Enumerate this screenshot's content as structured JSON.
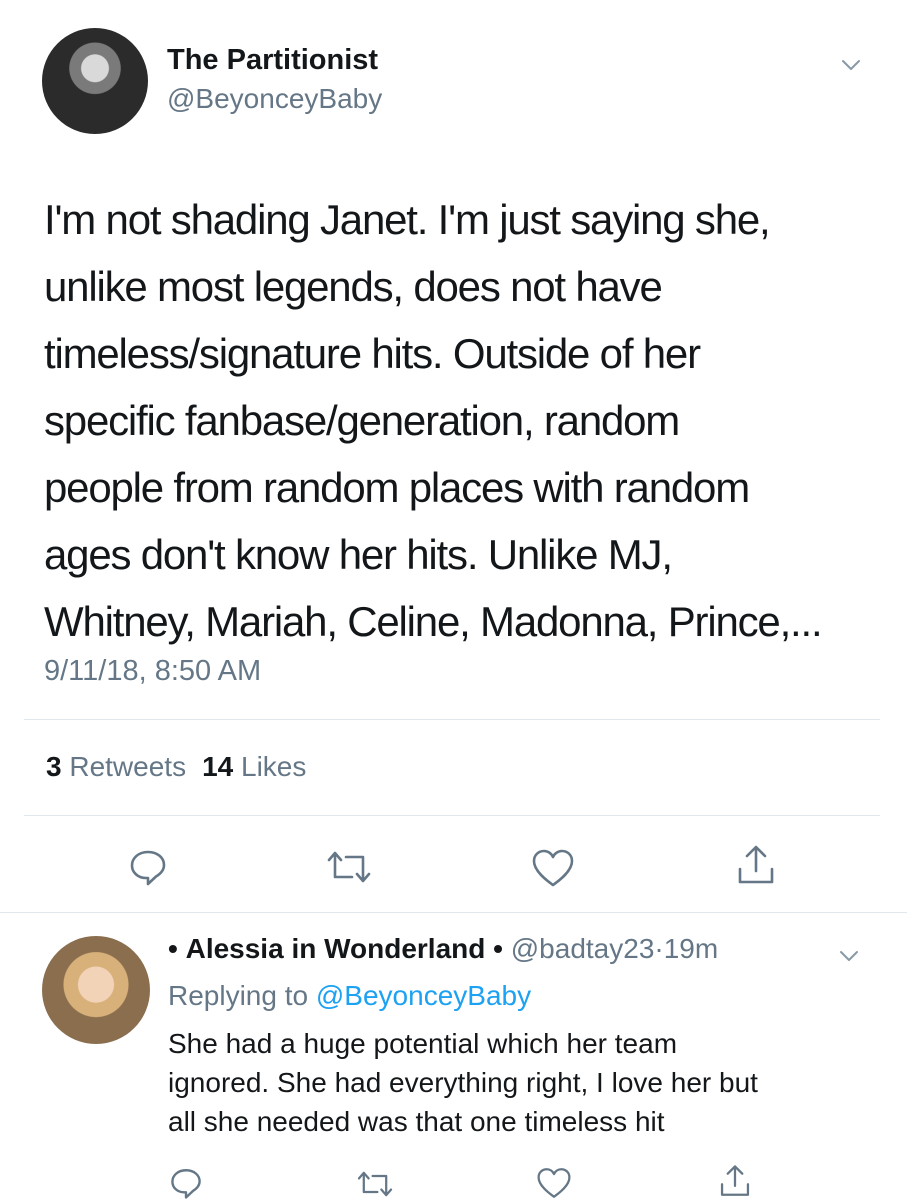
{
  "tweet": {
    "display_name": "The Partitionist",
    "handle": "@BeyonceyBaby",
    "text_lines": [
      "I'm not shading Janet. I'm just saying she,",
      "unlike most legends, does not have",
      "timeless/signature hits. Outside of her",
      "specific fanbase/generation, random",
      "people from random places with random",
      "ages don't know her hits. Unlike MJ,",
      "Whitney, Mariah, Celine, Madonna, Prince,..."
    ],
    "timestamp": "9/11/18, 8:50 AM",
    "retweets_count": "3",
    "retweets_label": "Retweets",
    "likes_count": "14",
    "likes_label": "Likes"
  },
  "actions": {
    "reply_icon": "reply-icon",
    "retweet_icon": "retweet-icon",
    "like_icon": "heart-icon",
    "share_icon": "share-icon"
  },
  "reply": {
    "bullet_before": "•",
    "display_name": "Alessia in Wonderland",
    "bullet_after": "•",
    "handle": "@badtay23",
    "separator": "·",
    "time_ago": "19m",
    "replying_prefix": "Replying to",
    "replying_mention": "@BeyonceyBaby",
    "text_lines": [
      "She had a huge potential which her team",
      "ignored. She had everything right, I love her but",
      "all she needed was that one timeless hit"
    ]
  },
  "colors": {
    "text_primary": "#14171a",
    "text_secondary": "#657786",
    "link": "#1da1f2",
    "divider": "#e1e8ed",
    "icon": "#657786"
  }
}
